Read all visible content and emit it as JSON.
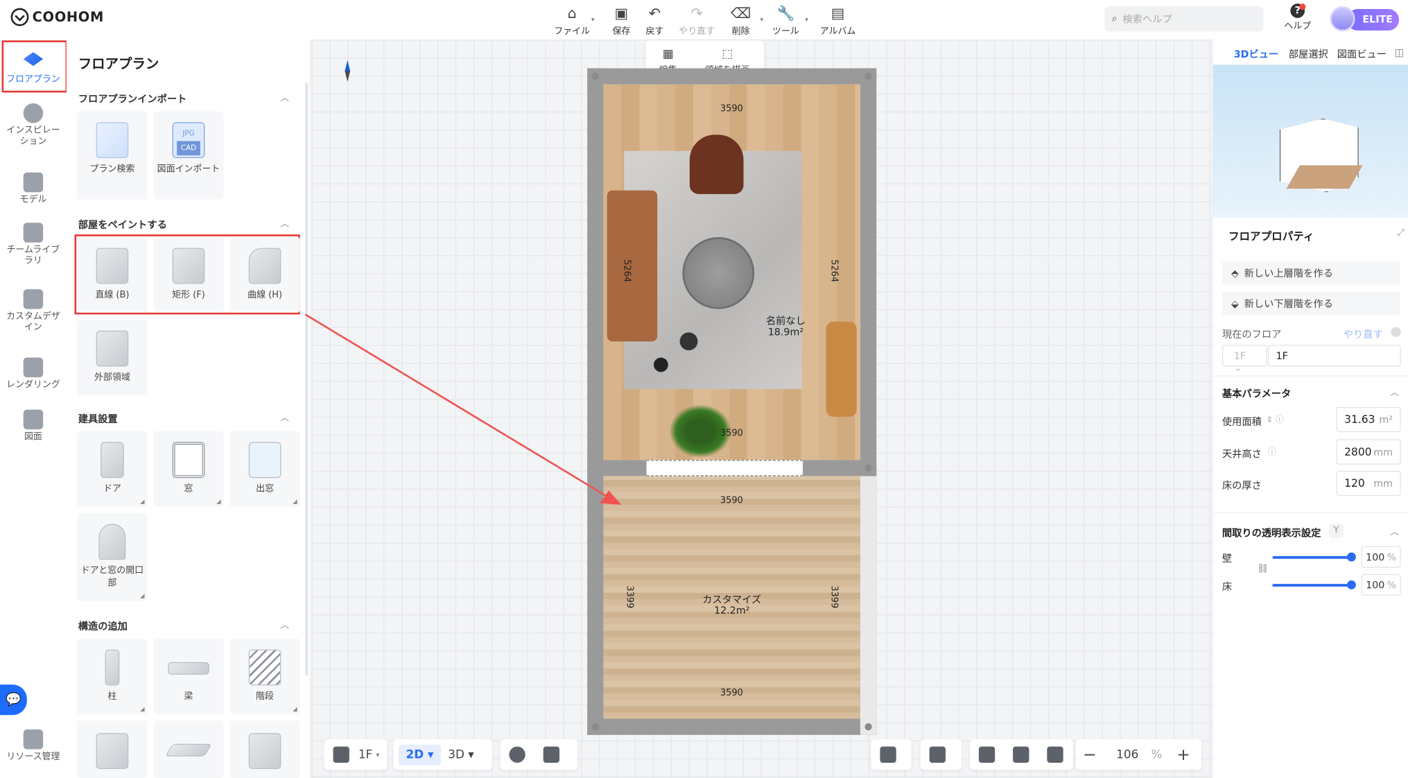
{
  "app": {
    "logo_text": "COOHOM",
    "accent": "#2a6df4",
    "highlight": "#e53935"
  },
  "toolbar": [
    {
      "label": "ファイル",
      "icon": "home-icon",
      "caret": true
    },
    {
      "label": "保存",
      "icon": "save-icon",
      "caret": false
    },
    {
      "label": "戻す",
      "icon": "undo-icon",
      "caret": false
    },
    {
      "label": "やり直す",
      "icon": "redo-icon",
      "caret": false,
      "disabled": true
    },
    {
      "label": "削除",
      "icon": "eraser-icon",
      "caret": true
    },
    {
      "label": "ツール",
      "icon": "wrench-icon",
      "caret": true
    },
    {
      "label": "アルバム",
      "icon": "album-icon",
      "caret": false
    }
  ],
  "search": {
    "placeholder": "検索ヘルプ"
  },
  "help": {
    "label": "ヘルプ"
  },
  "badge": {
    "label": "ELITE"
  },
  "rail": {
    "items": [
      {
        "label": "フロアプラン",
        "icon": "floorplan-icon",
        "active": true
      },
      {
        "label": "インスピレーション",
        "icon": "lightbulb-icon"
      },
      {
        "label": "モデル",
        "icon": "sofa-icon"
      },
      {
        "label": "チームライブラリ",
        "icon": "crown-icon"
      },
      {
        "label": "カスタムデザイン",
        "icon": "custom-design-icon"
      },
      {
        "label": "レンダリング",
        "icon": "camera-icon"
      },
      {
        "label": "図面",
        "icon": "drawing-icon"
      }
    ],
    "bottom": {
      "label": "リソース管理",
      "icon": "resource-icon"
    }
  },
  "panel": {
    "title": "フロアプラン",
    "sections": {
      "import": {
        "title": "フロアプランインポート",
        "items": [
          {
            "label": "プラン検索"
          },
          {
            "label": "図面インポート",
            "badges": [
              "JPG",
              "CAD"
            ]
          }
        ]
      },
      "paint": {
        "title": "部屋をペイントする",
        "items": [
          {
            "label": "直線 (B)"
          },
          {
            "label": "矩形 (F)"
          },
          {
            "label": "曲線 (H)"
          },
          {
            "label": "外部領域"
          }
        ]
      },
      "fixtures": {
        "title": "建具設置",
        "items": [
          {
            "label": "ドア"
          },
          {
            "label": "窓"
          },
          {
            "label": "出窓"
          },
          {
            "label": "ドアと窓の開口部"
          }
        ]
      },
      "structure": {
        "title": "構造の追加",
        "items": [
          {
            "label": "柱"
          },
          {
            "label": "梁"
          },
          {
            "label": "階段"
          }
        ]
      }
    }
  },
  "canvas": {
    "edit_tools": [
      {
        "label": "編集"
      },
      {
        "label": "領域を描画"
      }
    ],
    "rooms": [
      {
        "name": "名前なし",
        "area": "18.9m²",
        "dims": {
          "top": "3590",
          "bottom": "3590",
          "left": "5264",
          "right": "5264"
        }
      },
      {
        "name": "カスタマイズ",
        "area": "12.2m²",
        "dims": {
          "top": "3590",
          "bottom": "3590",
          "left": "3399",
          "right": "3399"
        }
      }
    ]
  },
  "bottom_bar": {
    "floor": "1F",
    "view_2d": "2D",
    "view_3d": "3D",
    "zoom": "106",
    "zoom_unit": "%"
  },
  "right": {
    "tabs": [
      {
        "label": "3Dビュー",
        "active": true
      },
      {
        "label": "部屋選択"
      },
      {
        "label": "図面ビュー"
      }
    ],
    "prop_title": "フロアプロパティ",
    "buttons": [
      {
        "label": "新しい上層階を作る"
      },
      {
        "label": "新しい下層階を作る"
      }
    ],
    "current_floor_label": "現在のフロア",
    "redo": "やり直す",
    "floor_select": "1F",
    "floor_name": "1F",
    "basic_title": "基本パラメータ",
    "params": [
      {
        "label": "使用面積",
        "value": "31.63",
        "unit": "m²"
      },
      {
        "label": "天井高さ",
        "value": "2800",
        "unit": "mm"
      },
      {
        "label": "床の厚さ",
        "value": "120",
        "unit": "mm"
      }
    ],
    "transparency_title": "間取りの透明表示設定",
    "transparency_key": "Y",
    "sliders": [
      {
        "label": "壁",
        "value": "100",
        "unit": "%",
        "level": 1.0
      },
      {
        "label": "床",
        "value": "100",
        "unit": "%",
        "level": 1.0
      }
    ]
  }
}
